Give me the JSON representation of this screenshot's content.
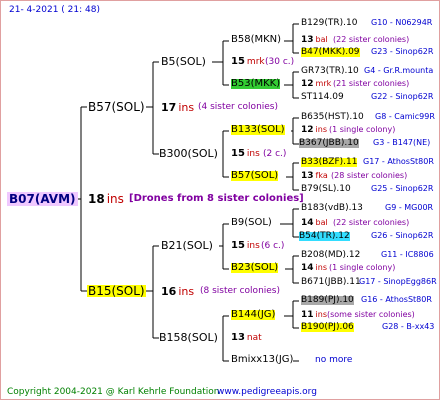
{
  "header": {
    "date": "21-  4-2021 ( 21: 48)"
  },
  "footer": {
    "copyright": "Copyright 2004-2021 @ Karl Kehrle Foundation",
    "site": "www.pedigreeapis.org"
  },
  "colors": {
    "line": "#000000",
    "yellow": "#ffff00",
    "green": "#33cc33",
    "gray": "#a8a8a8",
    "cyan": "#33ddff",
    "pink": "#f0c8ff",
    "red": "#c00000",
    "blue": "#0000d0",
    "purple": "#8000a0"
  },
  "root": {
    "name": "B07(AVM)",
    "ins_num": "18",
    "ins_word": "ins",
    "note": "[Drones from 8 sister colonies]"
  },
  "gen1": [
    {
      "name": "B57(SOL)",
      "ins_num": "17",
      "ins_word": "ins",
      "note": "(4 sister colonies)"
    },
    {
      "name": "B15(SOL)",
      "ins_num": "16",
      "ins_word": "ins",
      "note": "(8 sister colonies)"
    }
  ],
  "gen2": [
    {
      "name": "B5(SOL)",
      "ins_num": "15",
      "ins_word": "mrk",
      "note": "(30 c.)"
    },
    {
      "name": "B300(SOL)",
      "ins_num": "15",
      "ins_word": "ins",
      "note": "(2 c.)"
    },
    {
      "name": "B21(SOL)",
      "ins_num": "15",
      "ins_word": "ins",
      "note": "(6 c.)"
    },
    {
      "name": "B158(SOL)",
      "ins_num": "13",
      "ins_word": "nat",
      "note": ""
    }
  ],
  "gen3": [
    {
      "name": "B58(MKN)",
      "ins_num": "13",
      "ins_word": "bal",
      "note": "(22 sister colonies)"
    },
    {
      "name": "B53(MKK)",
      "ins_num": "12",
      "ins_word": "mrk",
      "note": "(21 sister colonies)"
    },
    {
      "name": "B133(SOL)",
      "ins_num": "12",
      "ins_word": "ins",
      "note": "(1 single colony)"
    },
    {
      "name": "B57(SOL)",
      "ins_num": "13",
      "ins_word": "fka",
      "note": "(28 sister colonies)"
    },
    {
      "name": "B9(SOL)",
      "ins_num": "14",
      "ins_word": "bal",
      "note": "(22 sister colonies)"
    },
    {
      "name": "B23(SOL)",
      "ins_num": "14",
      "ins_word": "ins",
      "note": "(1 single colony)"
    },
    {
      "name": "B144(JG)",
      "ins_num": "11",
      "ins_word": "ins",
      "note": "(some sister colonies)"
    },
    {
      "name": "Bmixx13(JG)",
      "ins_num": "",
      "ins_word": "",
      "note": "no more"
    }
  ],
  "gen4": [
    {
      "name": "B129(TR).10",
      "info": "G10 - N06294R"
    },
    {
      "name": "B47(MKK).09",
      "info": "G23 - Sinop62R"
    },
    {
      "name": "GR73(TR).10",
      "info": "G4 - Gr.R.mounta"
    },
    {
      "name": "ST114.09",
      "info": "G22 - Sinop62R"
    },
    {
      "name": "B635(HST).10",
      "info": "G8 - Camic99R"
    },
    {
      "name": "B367(JBB).10",
      "info": "G3 - B147(NE)"
    },
    {
      "name": "B33(BZF).11",
      "info": "G17 - AthosSt80R"
    },
    {
      "name": "B79(SL).10",
      "info": "G25 - Sinop62R"
    },
    {
      "name": "B183(vdB).13",
      "info": "G9 - MG00R"
    },
    {
      "name": "B54(TR).12",
      "info": "G26 - Sinop62R"
    },
    {
      "name": "B208(MD).12",
      "info": "G11 - IC8806"
    },
    {
      "name": "B671(JBB).11",
      "info": "G17 - SinopEgg86R"
    },
    {
      "name": "B189(PJ).10",
      "info": "G16 - AthosSt80R"
    },
    {
      "name": "B190(PJ).06",
      "info": "G28 - B-xx43"
    }
  ]
}
